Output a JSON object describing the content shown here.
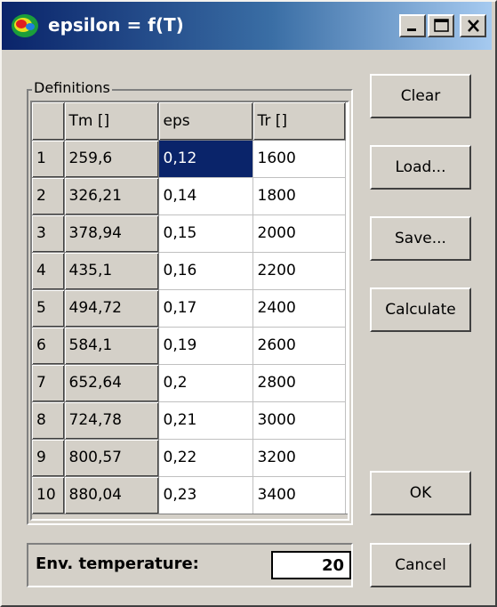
{
  "window": {
    "title": "epsilon = f(T)"
  },
  "colors": {
    "titlebar_start": "#0a246a",
    "titlebar_end": "#a6caf0",
    "face": "#d4d0c8",
    "selection": "#0a246a"
  },
  "group_label": "Definitions",
  "grid": {
    "columns": [
      "",
      "Tm []",
      "eps",
      "Tr []"
    ],
    "rows": [
      {
        "n": "1",
        "tm": "259,6",
        "eps": "0,12",
        "tr": "1600"
      },
      {
        "n": "2",
        "tm": "326,21",
        "eps": "0,14",
        "tr": "1800"
      },
      {
        "n": "3",
        "tm": "378,94",
        "eps": "0,15",
        "tr": "2000"
      },
      {
        "n": "4",
        "tm": "435,1",
        "eps": "0,16",
        "tr": "2200"
      },
      {
        "n": "5",
        "tm": "494,72",
        "eps": "0,17",
        "tr": "2400"
      },
      {
        "n": "6",
        "tm": "584,1",
        "eps": "0,19",
        "tr": "2600"
      },
      {
        "n": "7",
        "tm": "652,64",
        "eps": "0,2",
        "tr": "2800"
      },
      {
        "n": "8",
        "tm": "724,78",
        "eps": "0,21",
        "tr": "3000"
      },
      {
        "n": "9",
        "tm": "800,57",
        "eps": "0,22",
        "tr": "3200"
      },
      {
        "n": "10",
        "tm": "880,04",
        "eps": "0,23",
        "tr": "3400"
      }
    ],
    "selected_cell": "eps row 1"
  },
  "buttons": {
    "clear": "Clear",
    "load": "Load...",
    "save": "Save...",
    "calculate": "Calculate",
    "ok": "OK",
    "cancel": "Cancel"
  },
  "env": {
    "label": "Env. temperature:",
    "value": "20"
  },
  "icons": [
    "app-icon",
    "minimize-icon",
    "maximize-icon",
    "close-icon"
  ]
}
